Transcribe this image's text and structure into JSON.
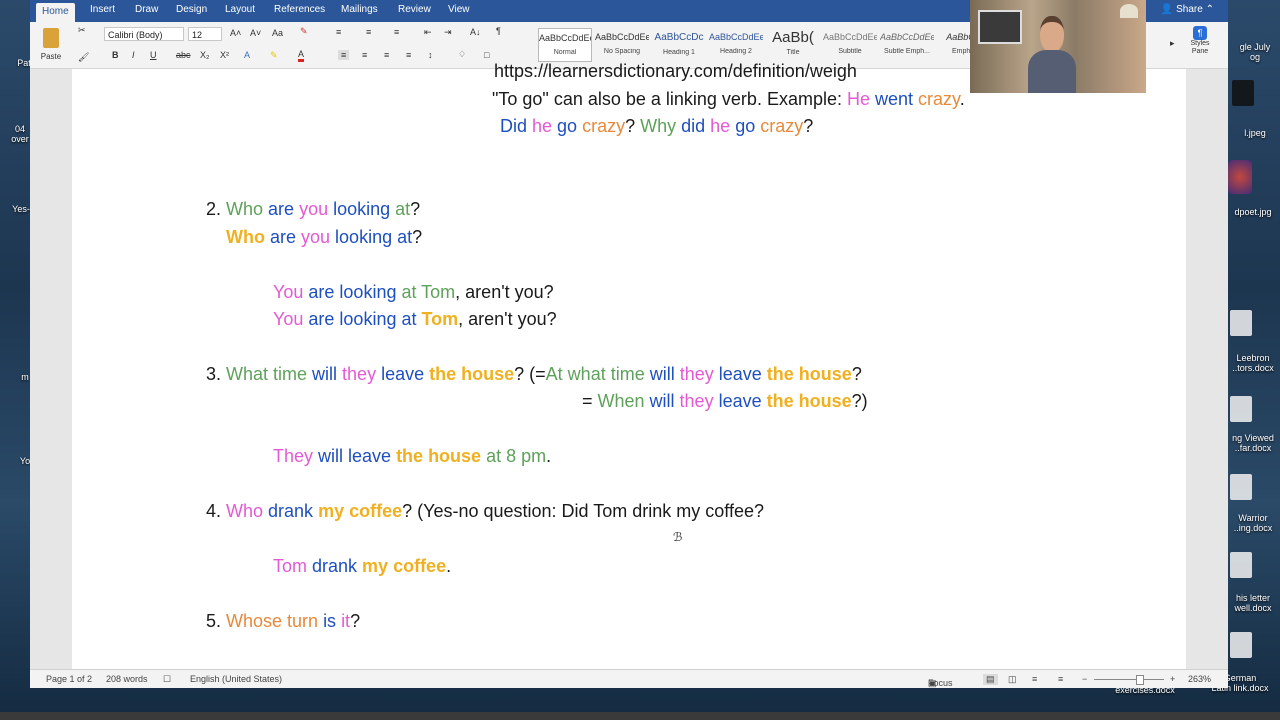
{
  "ribbon": {
    "tabs": [
      "Home",
      "Insert",
      "Draw",
      "Design",
      "Layout",
      "References",
      "Mailings",
      "Review",
      "View"
    ],
    "share_label": "Share",
    "paste_label": "Paste",
    "font_name": "Calibri (Body)",
    "font_size": "12",
    "styles": [
      {
        "sample": "AaBbCcDdEe",
        "name": "Normal"
      },
      {
        "sample": "AaBbCcDdEe",
        "name": "No Spacing"
      },
      {
        "sample": "AaBbCcDc",
        "name": "Heading 1"
      },
      {
        "sample": "AaBbCcDdEe",
        "name": "Heading 2"
      },
      {
        "sample": "AaBb(",
        "name": "Title"
      },
      {
        "sample": "AaBbCcDdEe",
        "name": "Subtitle"
      },
      {
        "sample": "AaBbCcDdEe",
        "name": "Subtle Emph..."
      },
      {
        "sample": "AaBbCcI",
        "name": "Emph..."
      }
    ],
    "styles_pane_label": "Styles Pane"
  },
  "desktop": {
    "left_labels": [
      "Pat",
      "04\nover",
      "Yes-",
      "m",
      "Yo"
    ],
    "right_labels": [
      "gle July\nog",
      "l.jpeg",
      "dpoet.jpg",
      "Leebron\n..tors.docx",
      "ng Viewed\n..far.docx",
      "Warrior\n..ing.docx",
      "his letter\nwell.docx",
      "German\nLatin link.docx",
      "exercises.docx"
    ]
  },
  "document": {
    "top_url": "https://learnersdictionary.com/definition/weigh",
    "lines": [
      {
        "id": "l1",
        "segs": [
          [
            "k",
            "\"To go\" can also be a linking verb. Example: "
          ],
          [
            "p",
            "He "
          ],
          [
            "b",
            "went "
          ],
          [
            "o",
            "crazy"
          ],
          [
            "k",
            "."
          ]
        ]
      },
      {
        "id": "l2",
        "segs": [
          [
            "b",
            "Did "
          ],
          [
            "p",
            "he "
          ],
          [
            "b",
            "go "
          ],
          [
            "o",
            "crazy"
          ],
          [
            "k",
            "? "
          ],
          [
            "g",
            "Why "
          ],
          [
            "b",
            "did "
          ],
          [
            "p",
            "he "
          ],
          [
            "b",
            "go "
          ],
          [
            "o",
            "crazy"
          ],
          [
            "k",
            "?"
          ]
        ]
      },
      {
        "id": "l3",
        "segs": [
          [
            "k",
            "2. "
          ],
          [
            "g",
            "Who "
          ],
          [
            "b",
            "are "
          ],
          [
            "p",
            "you "
          ],
          [
            "b",
            "looking "
          ],
          [
            "g",
            "at"
          ],
          [
            "k",
            "?"
          ]
        ]
      },
      {
        "id": "l4",
        "segs": [
          [
            "y",
            "Who "
          ],
          [
            "b",
            "are "
          ],
          [
            "p",
            "you "
          ],
          [
            "b",
            "looking "
          ],
          [
            "b",
            "at"
          ],
          [
            "k",
            "?"
          ]
        ]
      },
      {
        "id": "l5",
        "segs": [
          [
            "p",
            "You "
          ],
          [
            "b",
            "are "
          ],
          [
            "b",
            "looking "
          ],
          [
            "g",
            "at Tom"
          ],
          [
            "k",
            ", aren't you?"
          ]
        ]
      },
      {
        "id": "l6",
        "segs": [
          [
            "p",
            "You "
          ],
          [
            "b",
            "are "
          ],
          [
            "b",
            "looking "
          ],
          [
            "b",
            "at "
          ],
          [
            "y",
            "Tom"
          ],
          [
            "k",
            ", aren't you?"
          ]
        ]
      },
      {
        "id": "l7",
        "segs": [
          [
            "k",
            "3. "
          ],
          [
            "g",
            "What time "
          ],
          [
            "b",
            "will "
          ],
          [
            "p",
            "they "
          ],
          [
            "b",
            "leave "
          ],
          [
            "y",
            "the house"
          ],
          [
            "k",
            "? (="
          ],
          [
            "g",
            "At what time "
          ],
          [
            "b",
            "will "
          ],
          [
            "p",
            "they "
          ],
          [
            "b",
            "leave "
          ],
          [
            "y",
            "the house"
          ],
          [
            "k",
            "?"
          ]
        ]
      },
      {
        "id": "l8",
        "segs": [
          [
            "k",
            "= "
          ],
          [
            "g",
            "When "
          ],
          [
            "b",
            "will "
          ],
          [
            "p",
            "they "
          ],
          [
            "b",
            "leave "
          ],
          [
            "y",
            "the house"
          ],
          [
            "k",
            "?)"
          ]
        ]
      },
      {
        "id": "l9",
        "segs": [
          [
            "p",
            "They "
          ],
          [
            "b",
            "will leave "
          ],
          [
            "y",
            "the house "
          ],
          [
            "g",
            "at 8 pm"
          ],
          [
            "k",
            "."
          ]
        ]
      },
      {
        "id": "l10",
        "segs": [
          [
            "k",
            "4. "
          ],
          [
            "p",
            "Who "
          ],
          [
            "b",
            "drank "
          ],
          [
            "y",
            "my coffee"
          ],
          [
            "k",
            "?  (Yes-no question: Did Tom drink my coffee?"
          ]
        ]
      },
      {
        "id": "l11",
        "segs": [
          [
            "p",
            "Tom "
          ],
          [
            "b",
            "drank "
          ],
          [
            "y",
            "my coffee"
          ],
          [
            "k",
            "."
          ]
        ]
      },
      {
        "id": "l12",
        "segs": [
          [
            "k",
            "5. "
          ],
          [
            "o",
            "Whose turn "
          ],
          [
            "b",
            "is "
          ],
          [
            "p",
            "it"
          ],
          [
            "k",
            "?"
          ]
        ]
      }
    ]
  },
  "status": {
    "page": "Page 1 of 2",
    "words": "208 words",
    "language": "English (United States)",
    "focus": "Focus",
    "zoom": "263%"
  }
}
